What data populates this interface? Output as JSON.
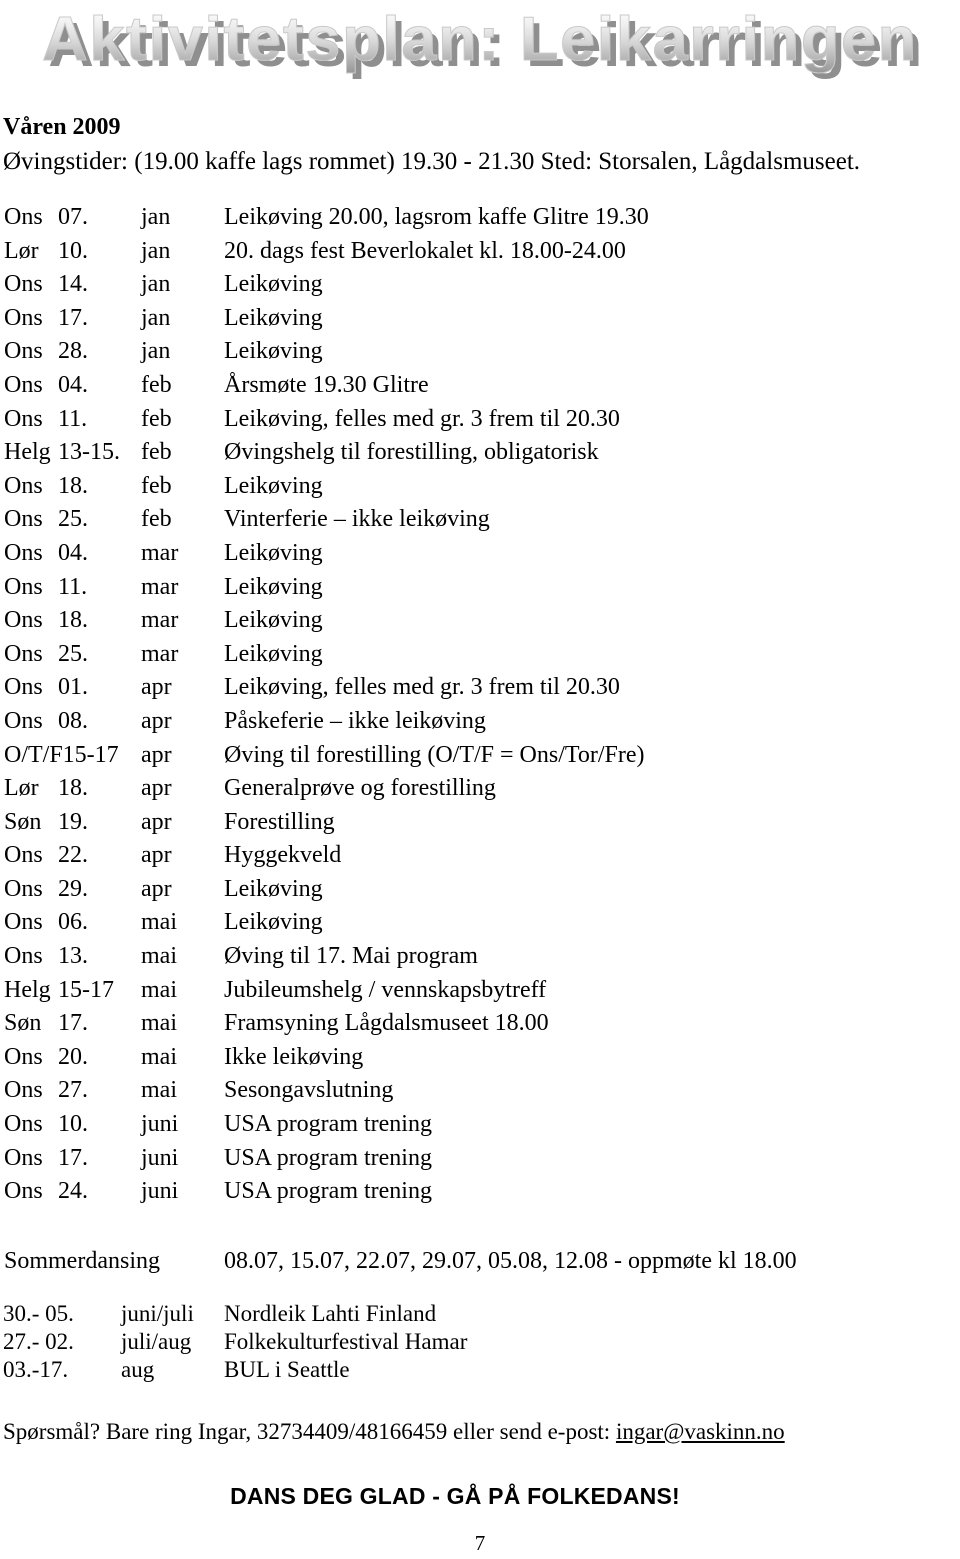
{
  "document": {
    "title_wordart": "Aktivitetsplan: Leikarringen",
    "season_heading": "Våren 2009",
    "practice_times": "Øvingstider: (19.00 kaffe lags rommet) 19.30 - 21.30 Sted: Storsalen, Lågdalsmuseet.",
    "page_number": "7"
  },
  "schedule": {
    "rows": [
      {
        "day": "Ons",
        "date": "07.",
        "month": "jan",
        "desc": "Leikøving 20.00, lagsrom kaffe Glitre 19.30"
      },
      {
        "day": "Lør",
        "date": "10.",
        "month": "jan",
        "desc": "20. dags fest Beverlokalet kl. 18.00-24.00"
      },
      {
        "day": "Ons",
        "date": "14.",
        "month": "jan",
        "desc": "Leikøving"
      },
      {
        "day": "Ons",
        "date": "17.",
        "month": "jan",
        "desc": "Leikøving"
      },
      {
        "day": "Ons",
        "date": "28.",
        "month": "jan",
        "desc": "Leikøving"
      },
      {
        "day": "Ons",
        "date": "04.",
        "month": "feb",
        "desc": "Årsmøte 19.30 Glitre"
      },
      {
        "day": "Ons",
        "date": "11.",
        "month": "feb",
        "desc": "Leikøving, felles med gr. 3 frem til 20.30"
      },
      {
        "day": "Helg",
        "date": "13-15.",
        "month": "feb",
        "desc": "Øvingshelg til forestilling, obligatorisk"
      },
      {
        "day": "Ons",
        "date": "18.",
        "month": "feb",
        "desc": "Leikøving"
      },
      {
        "day": "Ons",
        "date": "25.",
        "month": "feb",
        "desc": "Vinterferie – ikke leikøving"
      },
      {
        "day": "Ons",
        "date": "04.",
        "month": "mar",
        "desc": "Leikøving"
      },
      {
        "day": "Ons",
        "date": "11.",
        "month": "mar",
        "desc": "Leikøving"
      },
      {
        "day": "Ons",
        "date": "18.",
        "month": "mar",
        "desc": "Leikøving"
      },
      {
        "day": "Ons",
        "date": "25.",
        "month": "mar",
        "desc": "Leikøving"
      },
      {
        "day": "Ons",
        "date": "01.",
        "month": "apr",
        "desc": "Leikøving, felles med gr. 3 frem til 20.30"
      },
      {
        "day": "Ons",
        "date": "08.",
        "month": "apr",
        "desc": "Påskeferie – ikke leikøving"
      },
      {
        "day": "O/T/F15-17",
        "date": "",
        "month": "apr",
        "desc": "Øving til forestilling (O/T/F = Ons/Tor/Fre)",
        "wide": true
      },
      {
        "day": "Lør",
        "date": "18.",
        "month": "apr",
        "desc": "Generalprøve og forestilling"
      },
      {
        "day": "Søn",
        "date": "19.",
        "month": "apr",
        "desc": "Forestilling"
      },
      {
        "day": "Ons",
        "date": "22.",
        "month": "apr",
        "desc": "Hyggekveld"
      },
      {
        "day": "Ons",
        "date": "29.",
        "month": "apr",
        "desc": "Leikøving"
      },
      {
        "day": "Ons",
        "date": "06.",
        "month": "mai",
        "desc": "Leikøving"
      },
      {
        "day": "Ons",
        "date": "13.",
        "month": "mai",
        "desc": "Øving til 17. Mai program"
      },
      {
        "day": "Helg",
        "date": "15-17",
        "month": "mai",
        "desc": "Jubileumshelg / vennskapsbytreff"
      },
      {
        "day": "Søn",
        "date": "17.",
        "month": "mai",
        "desc": "Framsyning Lågdalsmuseet 18.00"
      },
      {
        "day": "Ons",
        "date": "20.",
        "month": "mai",
        "desc": "Ikke leikøving"
      },
      {
        "day": "Ons",
        "date": "27.",
        "month": "mai",
        "desc": "Sesongavslutning"
      },
      {
        "day": "Ons",
        "date": "10.",
        "month": "juni",
        "desc": "USA program trening"
      },
      {
        "day": "Ons",
        "date": "17.",
        "month": "juni",
        "desc": "USA program trening"
      },
      {
        "day": "Ons",
        "date": "24.",
        "month": "juni",
        "desc": "USA program trening"
      }
    ]
  },
  "summer_dancing": {
    "label": "Sommerdansing",
    "dates": "08.07,  15.07, 22.07, 29.07, 05.08, 12.08 -  oppmøte kl 18.00"
  },
  "festivals": {
    "rows": [
      {
        "date": "30.- 05.",
        "month": "juni/juli",
        "desc": "Nordleik Lahti Finland"
      },
      {
        "date": "27.- 02.",
        "month": "juli/aug",
        "desc": "Folkekulturfestival Hamar"
      },
      {
        "date": "03.-17.",
        "month": "aug",
        "desc": "BUL i Seattle"
      }
    ]
  },
  "footer": {
    "contact_prefix": "Spørsmål? Bare ring Ingar, 32734409/48166459 eller send e-post: ",
    "contact_email": "ingar@vaskinn.no",
    "slogan": "DANS DEG GLAD - GÅ PÅ FOLKEDANS!"
  }
}
